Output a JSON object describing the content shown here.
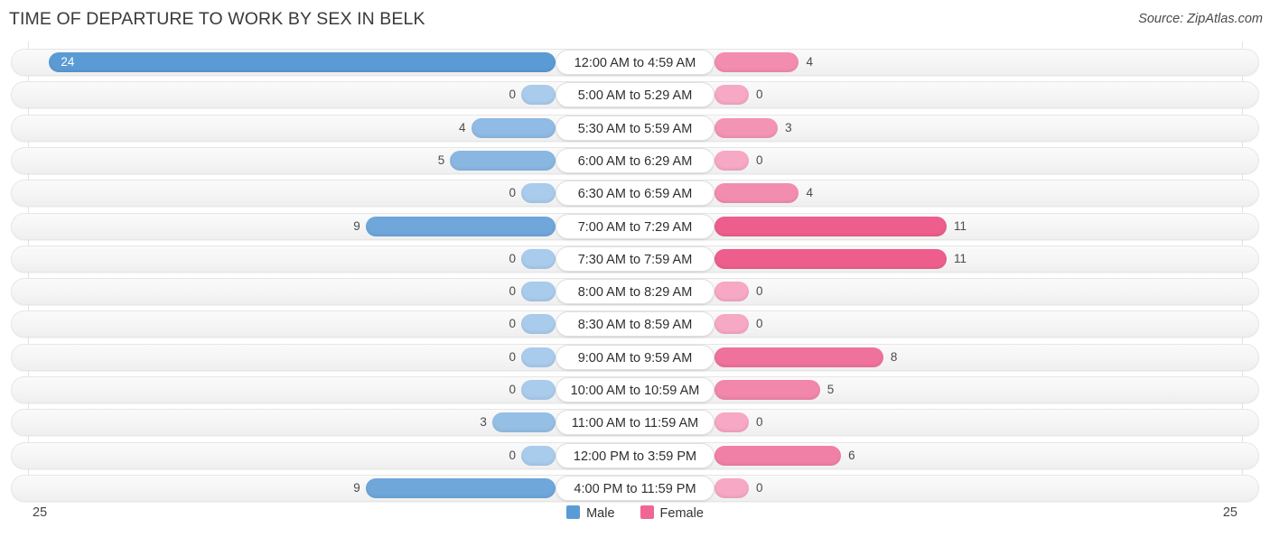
{
  "header": {
    "title": "TIME OF DEPARTURE TO WORK BY SEX IN BELK",
    "source": "Source: ZipAtlas.com"
  },
  "axis": {
    "left_tick": "25",
    "right_tick": "25"
  },
  "legend": {
    "items": [
      {
        "label": "Male",
        "color": "#5B9BD5"
      },
      {
        "label": "Female",
        "color": "#EF6694"
      }
    ]
  },
  "chart_data": {
    "type": "bar",
    "title": "TIME OF DEPARTURE TO WORK BY SEX IN BELK",
    "subtitle": "Source: ZipAtlas.com",
    "orientation": "horizontal-diverging",
    "xlabel": "",
    "ylabel": "",
    "xlim": [
      25,
      25
    ],
    "grid": true,
    "legend_position": "bottom-center",
    "categories": [
      "12:00 AM to 4:59 AM",
      "5:00 AM to 5:29 AM",
      "5:30 AM to 5:59 AM",
      "6:00 AM to 6:29 AM",
      "6:30 AM to 6:59 AM",
      "7:00 AM to 7:29 AM",
      "7:30 AM to 7:59 AM",
      "8:00 AM to 8:29 AM",
      "8:30 AM to 8:59 AM",
      "9:00 AM to 9:59 AM",
      "10:00 AM to 10:59 AM",
      "11:00 AM to 11:59 AM",
      "12:00 PM to 3:59 PM",
      "4:00 PM to 11:59 PM"
    ],
    "series": [
      {
        "name": "Male",
        "color": "#5B9BD5",
        "values": [
          24,
          0,
          4,
          5,
          0,
          9,
          0,
          0,
          0,
          0,
          0,
          3,
          0,
          9
        ]
      },
      {
        "name": "Female",
        "color": "#EF6694",
        "values": [
          4,
          0,
          3,
          0,
          4,
          11,
          11,
          0,
          0,
          8,
          5,
          0,
          6,
          0
        ]
      }
    ]
  },
  "rows": [
    {
      "label": "12:00 AM to 4:59 AM",
      "male": "24",
      "female": "4"
    },
    {
      "label": "5:00 AM to 5:29 AM",
      "male": "0",
      "female": "0"
    },
    {
      "label": "5:30 AM to 5:59 AM",
      "male": "4",
      "female": "3"
    },
    {
      "label": "6:00 AM to 6:29 AM",
      "male": "5",
      "female": "0"
    },
    {
      "label": "6:30 AM to 6:59 AM",
      "male": "0",
      "female": "4"
    },
    {
      "label": "7:00 AM to 7:29 AM",
      "male": "9",
      "female": "11"
    },
    {
      "label": "7:30 AM to 7:59 AM",
      "male": "0",
      "female": "11"
    },
    {
      "label": "8:00 AM to 8:29 AM",
      "male": "0",
      "female": "0"
    },
    {
      "label": "8:30 AM to 8:59 AM",
      "male": "0",
      "female": "0"
    },
    {
      "label": "9:00 AM to 9:59 AM",
      "male": "0",
      "female": "8"
    },
    {
      "label": "10:00 AM to 10:59 AM",
      "male": "0",
      "female": "5"
    },
    {
      "label": "11:00 AM to 11:59 AM",
      "male": "3",
      "female": "0"
    },
    {
      "label": "12:00 PM to 3:59 PM",
      "male": "0",
      "female": "6"
    },
    {
      "label": "4:00 PM to 11:59 PM",
      "male": "9",
      "female": "0"
    }
  ]
}
